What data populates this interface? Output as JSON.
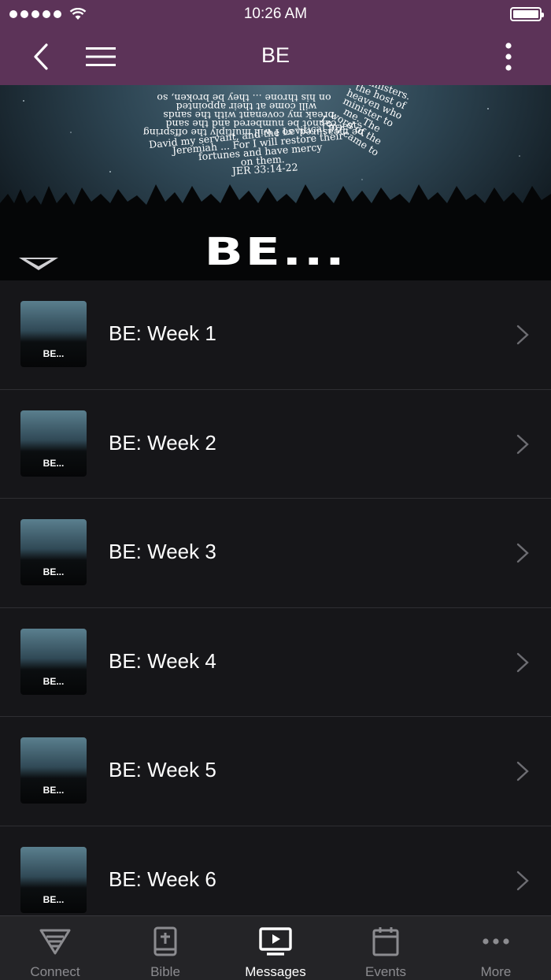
{
  "status_bar": {
    "time": "10:26 AM"
  },
  "nav": {
    "title": "BE"
  },
  "banner": {
    "title": "BE...",
    "verse_lines": [
      "on his throne ... they be broken, so",
      "will come at their appointed",
      "break my covenant with the sands",
      "cannot be numbered and the sand",
      "be measured, so I will multiply the offspring",
      "David my servant, and the Levitical priests",
      "Jeremiah ... For I will restore their",
      "fortunes and have mercy",
      "on them.",
      "JER 33:14-22"
    ],
    "right_lines": [
      "ministers.",
      "the host of",
      "heaven who",
      "minister to",
      "me. The",
      "word of the",
      "Lord came to"
    ]
  },
  "messages": [
    {
      "label": "BE: Week 1",
      "thumb_label": "BE..."
    },
    {
      "label": "BE: Week 2",
      "thumb_label": "BE..."
    },
    {
      "label": "BE: Week 3",
      "thumb_label": "BE..."
    },
    {
      "label": "BE: Week 4",
      "thumb_label": "BE..."
    },
    {
      "label": "BE: Week 5",
      "thumb_label": "BE..."
    },
    {
      "label": "BE: Week 6",
      "thumb_label": "BE..."
    }
  ],
  "tabs": [
    {
      "label": "Connect",
      "icon": "connect-icon"
    },
    {
      "label": "Bible",
      "icon": "bible-icon"
    },
    {
      "label": "Messages",
      "icon": "messages-icon",
      "active": true
    },
    {
      "label": "Events",
      "icon": "calendar-icon"
    },
    {
      "label": "More",
      "icon": "more-dots-icon"
    }
  ],
  "colors": {
    "nav_bg": "#5c3358",
    "list_bg": "#161619",
    "tab_bg": "#242427",
    "tab_inactive": "#8c8c90",
    "tab_active": "#ffffff"
  }
}
